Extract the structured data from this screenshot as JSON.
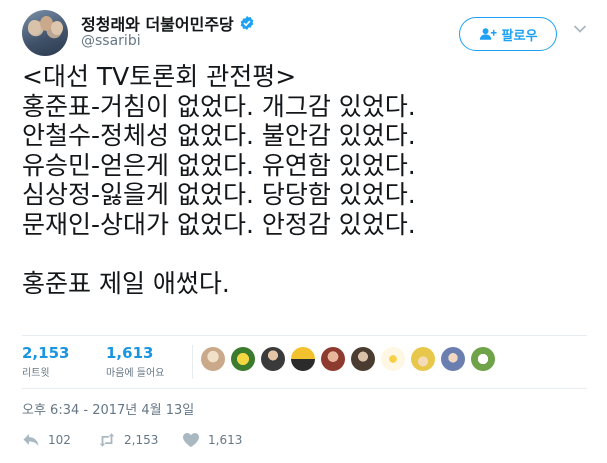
{
  "user": {
    "display_name": "정청래와 더불어민주당",
    "handle": "@ssaribi",
    "verified": true
  },
  "follow_button": {
    "label": "팔로우"
  },
  "tweet": {
    "lines": [
      "<대선 TV토론회 관전평>",
      "홍준표-거침이 없었다. 개그감 있었다.",
      "안철수-정체성 없었다. 불안감 있었다.",
      "유승민-얻은게 없었다. 유연함 있었다.",
      "심상정-잃을게 없었다. 당당함 있었다.",
      "문재인-상대가 없었다. 안정감 있었다.",
      "",
      "홍준표 제일 애썼다."
    ]
  },
  "stats": {
    "retweets": {
      "count": "2,153",
      "label": "리트윗"
    },
    "likes": {
      "count": "1,613",
      "label": "마음에 들어요"
    }
  },
  "likers": [
    {
      "icon": "liker-avatar-1"
    },
    {
      "icon": "liker-avatar-2"
    },
    {
      "icon": "liker-avatar-3"
    },
    {
      "icon": "liker-avatar-4"
    },
    {
      "icon": "liker-avatar-5"
    },
    {
      "icon": "liker-avatar-6"
    },
    {
      "icon": "liker-avatar-7"
    },
    {
      "icon": "liker-avatar-8"
    },
    {
      "icon": "liker-avatar-9"
    },
    {
      "icon": "liker-avatar-10"
    }
  ],
  "timestamp": "오후 6:34 - 2017년 4월 13일",
  "actions": {
    "reply_count": "102",
    "retweet_count": "2,153",
    "like_count": "1,613"
  },
  "colors": {
    "accent": "#1da1f2",
    "link": "#1b95e0",
    "muted": "#657786",
    "text": "#14171a",
    "border": "#e6ecf0"
  }
}
